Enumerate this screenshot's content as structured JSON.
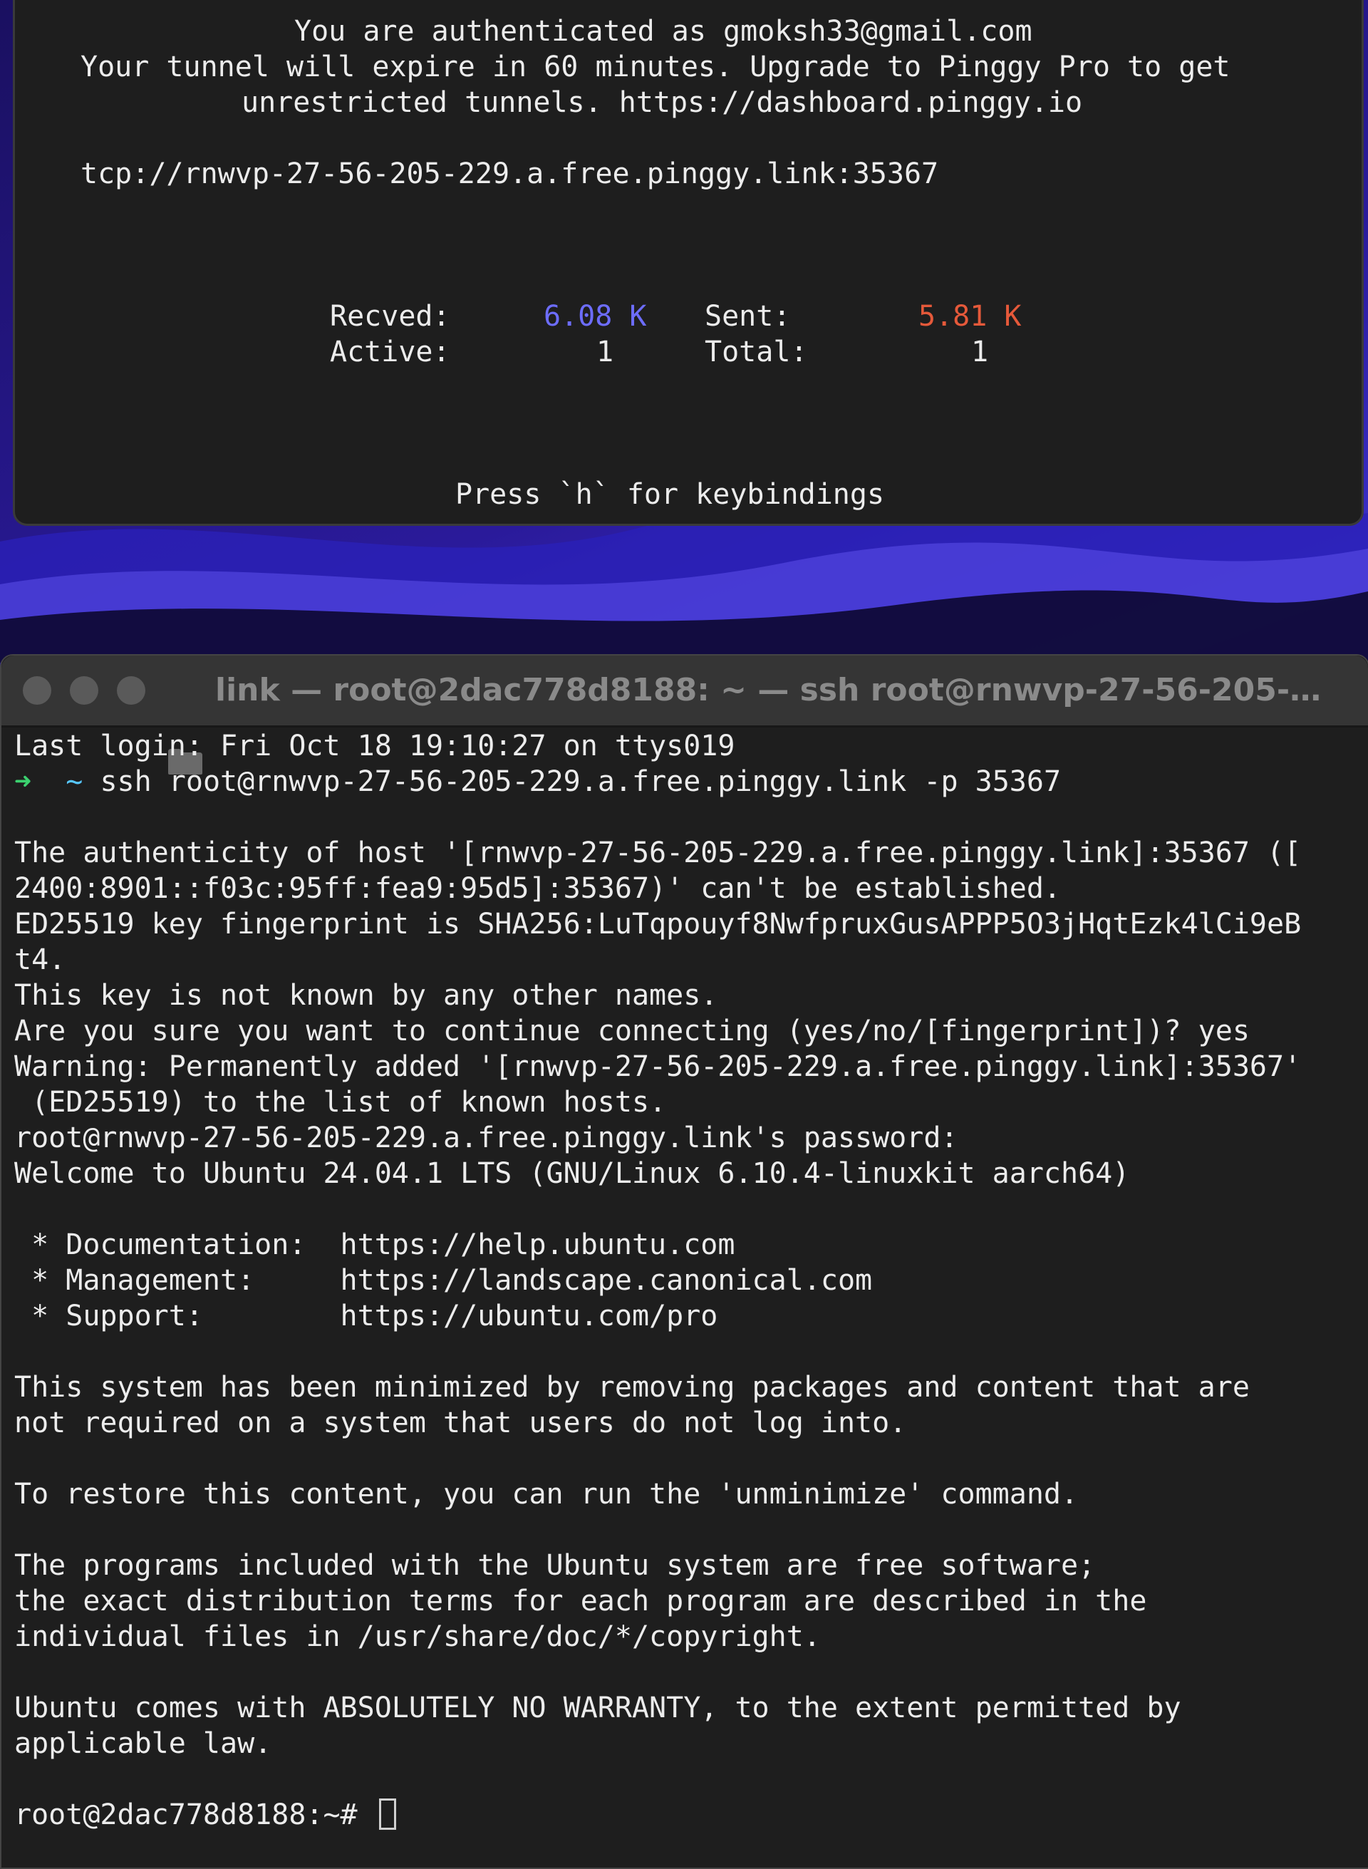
{
  "pinggy": {
    "auth_line": "You are authenticated as gmoksh33@gmail.com",
    "expire_line_1": "Your tunnel will expire in 60 minutes. Upgrade to Pinggy Pro to get",
    "expire_line_2": "unrestricted tunnels. https://dashboard.pinggy.io",
    "tunnel_url": "tcp://rnwvp-27-56-205-229.a.free.pinggy.link:35367",
    "stats": {
      "recved_label": "Recved:",
      "recved_value": "6.08 K",
      "sent_label": "Sent:",
      "sent_value": "5.81 K",
      "active_label": "Active:",
      "active_value": "1",
      "total_label": "Total:",
      "total_value": "1"
    },
    "help_hint": "Press `h` for keybindings"
  },
  "ssh_window": {
    "title": "link — root@2dac778d8188: ~ — ssh root@rnwvp-27-56-205-229.a...",
    "prompt_arrow": "➜",
    "prompt_dir": "~",
    "command": "ssh root@rnwvp-27-56-205-229.a.free.pinggy.link -p 35367",
    "lines": [
      "Last login: Fri Oct 18 19:10:27 on ttys019",
      "",
      "",
      "The authenticity of host '[rnwvp-27-56-205-229.a.free.pinggy.link]:35367 ([",
      "2400:8901::f03c:95ff:fea9:95d5]:35367)' can't be established.",
      "ED25519 key fingerprint is SHA256:LuTqpouyf8NwfpruxGusAPPP5O3jHqtEzk4lCi9eB",
      "t4.",
      "This key is not known by any other names.",
      "Are you sure you want to continue connecting (yes/no/[fingerprint])? yes",
      "Warning: Permanently added '[rnwvp-27-56-205-229.a.free.pinggy.link]:35367'",
      " (ED25519) to the list of known hosts.",
      "root@rnwvp-27-56-205-229.a.free.pinggy.link's password:",
      "Welcome to Ubuntu 24.04.1 LTS (GNU/Linux 6.10.4-linuxkit aarch64)",
      "",
      " * Documentation:  https://help.ubuntu.com",
      " * Management:     https://landscape.canonical.com",
      " * Support:        https://ubuntu.com/pro",
      "",
      "This system has been minimized by removing packages and content that are",
      "not required on a system that users do not log into.",
      "",
      "To restore this content, you can run the 'unminimize' command.",
      "",
      "The programs included with the Ubuntu system are free software;",
      "the exact distribution terms for each program are described in the",
      "individual files in /usr/share/doc/*/copyright.",
      "",
      "Ubuntu comes with ABSOLUTELY NO WARRANTY, to the extent permitted by",
      "applicable law.",
      "",
      "root@2dac778d8188:~#"
    ]
  }
}
